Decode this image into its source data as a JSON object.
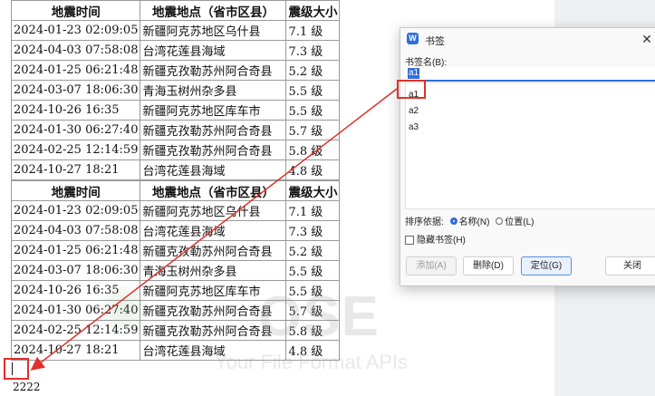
{
  "document": {
    "tables": [
      {
        "headers": [
          "地震时间",
          "地震地点（省市区县）",
          "震级大小"
        ],
        "rows": [
          [
            "2024-01-23 02:09:05",
            "新疆阿克苏地区乌什县",
            "7.1 级"
          ],
          [
            "2024-04-03 07:58:08",
            "台湾花莲县海域",
            "7.3 级"
          ],
          [
            "2024-01-25 06:21:48",
            "新疆克孜勒苏州阿合奇县",
            "5.2 级"
          ],
          [
            "2024-03-07 18:06:30",
            "青海玉树州杂多县",
            "5.5 级"
          ],
          [
            "2024-10-26 16:35",
            "新疆阿克苏地区库车市",
            "5.5 级"
          ],
          [
            "2024-01-30 06:27:40",
            "新疆克孜勒苏州阿合奇县",
            "5.7 级"
          ],
          [
            "2024-02-25 12:14:59",
            "新疆克孜勒苏州阿合奇县",
            "5.8 级"
          ],
          [
            "2024-10-27 18:21",
            "台湾花莲县海域",
            "4.8 级"
          ]
        ]
      },
      {
        "headers": [
          "地震时间",
          "地震地点（省市区县）",
          "震级大小"
        ],
        "rows": [
          [
            "2024-01-23 02:09:05",
            "新疆阿克苏地区乌什县",
            "7.1 级"
          ],
          [
            "2024-04-03 07:58:08",
            "台湾花莲县海域",
            "7.3 级"
          ],
          [
            "2024-01-25 06:21:48",
            "新疆克孜勒苏州阿合奇县",
            "5.2 级"
          ],
          [
            "2024-03-07 18:06:30",
            "青海玉树州杂多县",
            "5.5 级"
          ],
          [
            "2024-10-26 16:35",
            "新疆阿克苏地区库车市",
            "5.5 级"
          ],
          [
            "2024-01-30 06:27:40",
            "新疆克孜勒苏州阿合奇县",
            "5.7 级"
          ],
          [
            "2024-02-25 12:14:59",
            "新疆克孜勒苏州阿合奇县",
            "5.8 级"
          ],
          [
            "2024-10-27 18:21",
            "台湾花莲县海域",
            "4.8 级"
          ]
        ]
      }
    ],
    "trailing_text": "2222",
    "watermark": {
      "main": "OSE",
      "sub": "Your File Format APIs"
    }
  },
  "dialog": {
    "title": "书签",
    "app_icon": "W",
    "close_glyph": "✕",
    "bookmark_name_label": "书签名(B):",
    "bookmark_name_value": "a1",
    "bookmarks": [
      "a1",
      "a2",
      "a3"
    ],
    "selected_bookmark": "a1",
    "sort_label": "排序依据:",
    "sort_options": [
      "名称(N)",
      "位置(L)"
    ],
    "sort_selected": "名称(N)",
    "hidden_label": "隐藏书签(H)",
    "hidden_checked": false,
    "buttons": {
      "add": "添加(A)",
      "delete": "删除(D)",
      "goto": "定位(G)",
      "close": "关闭"
    }
  },
  "colors": {
    "accent": "#2f6fd8",
    "annotation_red": "#e1302a"
  }
}
